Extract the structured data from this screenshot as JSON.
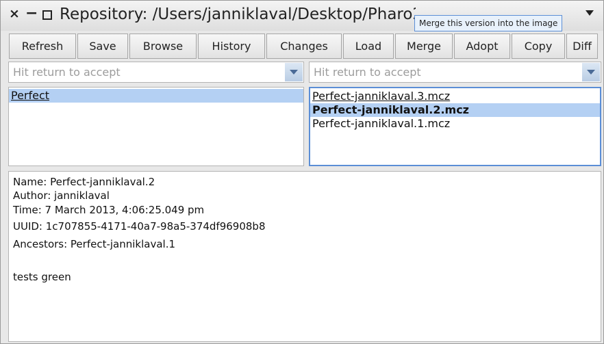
{
  "window": {
    "title": "Repository: /Users/janniklaval/Desktop/Pharo2.0/package-cache"
  },
  "tooltip": "Merge this version into the image",
  "toolbar": {
    "buttons": [
      "Refresh",
      "Save",
      "Browse",
      "History",
      "Changes",
      "Load",
      "Merge",
      "Adopt",
      "Copy",
      "Diff"
    ]
  },
  "filters": {
    "left_placeholder": "Hit return to accept",
    "right_placeholder": "Hit return to accept"
  },
  "packages": {
    "items": [
      "Perfect"
    ],
    "selected": "Perfect"
  },
  "versions": {
    "items": [
      "Perfect-janniklaval.3.mcz",
      "Perfect-janniklaval.2.mcz",
      "Perfect-janniklaval.1.mcz"
    ],
    "selected": "Perfect-janniklaval.2.mcz"
  },
  "info": {
    "name": "Name: Perfect-janniklaval.2",
    "author": "Author: janniklaval",
    "time": "Time: 7 March 2013, 4:06:25.049 pm",
    "uuid": "UUID: 1c707855-4171-40a7-98a5-374df96908b8",
    "ancestors": "Ancestors: Perfect-janniklaval.1",
    "message": "tests green"
  }
}
